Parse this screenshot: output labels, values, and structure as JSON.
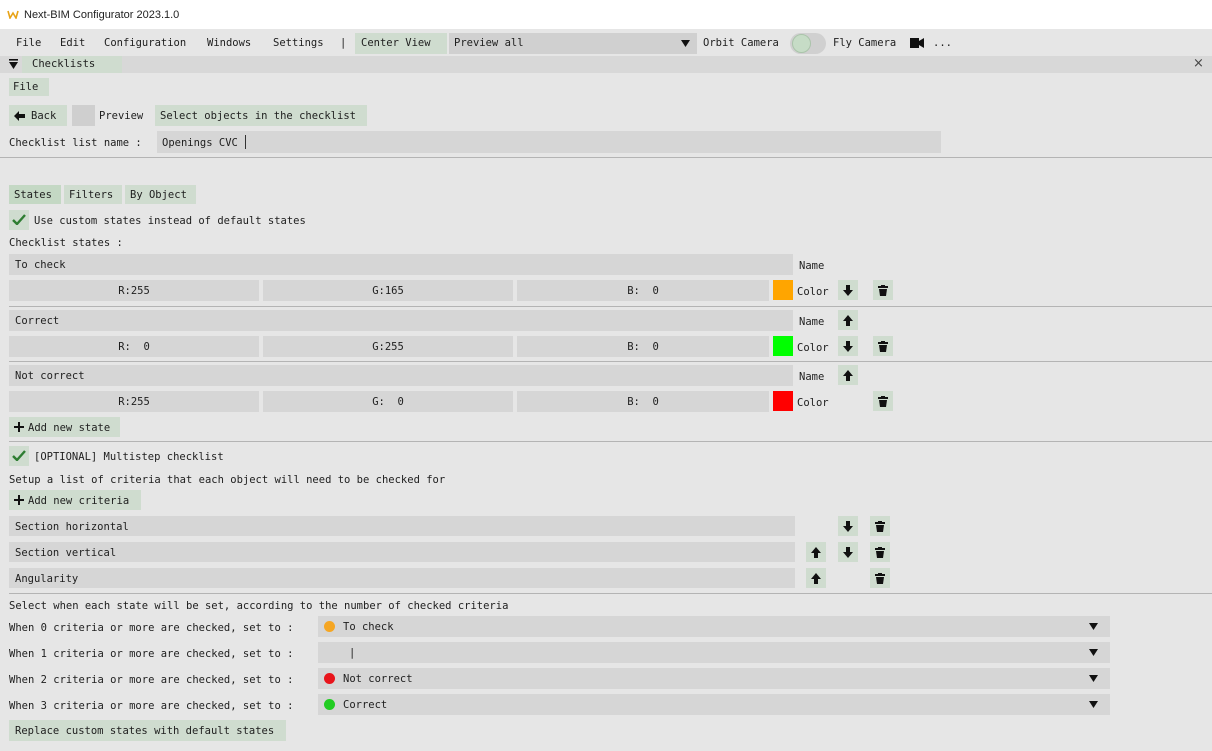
{
  "window": {
    "title": "Next-BIM Configurator 2023.1.0"
  },
  "menubar": {
    "items": [
      "File",
      "Edit",
      "Configuration",
      "Windows",
      "Settings"
    ],
    "separator": "|",
    "center_view": "Center View",
    "preview_mode": "Preview all",
    "orbit_camera": "Orbit Camera",
    "fly_camera": "Fly Camera",
    "more": "..."
  },
  "panel": {
    "title": "Checklists",
    "close": "×",
    "file_menu": "File",
    "back": "Back",
    "preview": "Preview",
    "select_objects": "Select objects in the checklist",
    "name_label": "Checklist list name :",
    "name_value": "Openings CVC"
  },
  "tabs": [
    "States",
    "Filters",
    "By Object"
  ],
  "states_section": {
    "use_custom_label": "Use custom states instead of default states",
    "states_label": "Checklist states :",
    "states": [
      {
        "name": "To check",
        "r": "R:255",
        "g": "G:165",
        "b": "B:  0",
        "color": "#ffa500"
      },
      {
        "name": "Correct",
        "r": "R:  0",
        "g": "G:255",
        "b": "B:  0",
        "color": "#00ff00"
      },
      {
        "name": "Not correct",
        "r": "R:255",
        "g": "G:  0",
        "b": "B:  0",
        "color": "#ff0000"
      }
    ],
    "name_tag": "Name",
    "color_tag": "Color",
    "add_state": "Add new state"
  },
  "multistep": {
    "label": "[OPTIONAL] Multistep checklist",
    "setup_text": "Setup a list of criteria that each object will need to be checked for",
    "add_criteria": "Add new criteria",
    "criteria": [
      "Section horizontal",
      "Section vertical",
      "Angularity"
    ],
    "select_when": "Select when each state will be set, according to the number of checked criteria",
    "rules": [
      {
        "label": "When 0 criteria or more are checked, set to :",
        "value": "To check",
        "dot": "#f5a623"
      },
      {
        "label": "When 1 criteria or more are checked, set to :",
        "value": "|",
        "dot": ""
      },
      {
        "label": "When 2 criteria or more are checked, set to :",
        "value": "Not correct",
        "dot": "#e8141b"
      },
      {
        "label": "When 3 criteria or more are checked, set to :",
        "value": "Correct",
        "dot": "#22cc22"
      }
    ],
    "replace_button": "Replace custom states with default states"
  }
}
